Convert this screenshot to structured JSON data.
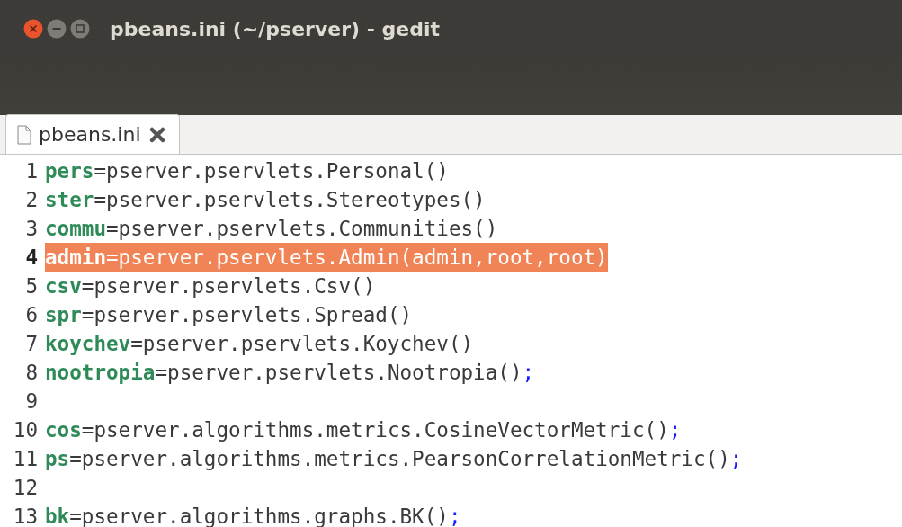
{
  "window": {
    "title": "pbeans.ini (~/pserver) - gedit"
  },
  "tabs": [
    {
      "label": "pbeans.ini",
      "selected": true
    }
  ],
  "lines": [
    {
      "number": "1",
      "selected": false,
      "tokens": [
        {
          "kind": "key",
          "text": "pers"
        },
        {
          "kind": "plain",
          "text": "=pserver.pservlets.Personal()"
        }
      ]
    },
    {
      "number": "2",
      "selected": false,
      "tokens": [
        {
          "kind": "key",
          "text": "ster"
        },
        {
          "kind": "plain",
          "text": "=pserver.pservlets.Stereotypes()"
        }
      ]
    },
    {
      "number": "3",
      "selected": false,
      "tokens": [
        {
          "kind": "key",
          "text": "commu"
        },
        {
          "kind": "plain",
          "text": "=pserver.pservlets.Communities()"
        }
      ]
    },
    {
      "number": "4",
      "selected": true,
      "tokens": [
        {
          "kind": "key",
          "text": "admin"
        },
        {
          "kind": "plain",
          "text": "=pserver.pservlets.Admin(admin,root,root)"
        }
      ]
    },
    {
      "number": "5",
      "selected": false,
      "tokens": [
        {
          "kind": "key",
          "text": "csv"
        },
        {
          "kind": "plain",
          "text": "=pserver.pservlets.Csv()"
        }
      ]
    },
    {
      "number": "6",
      "selected": false,
      "tokens": [
        {
          "kind": "key",
          "text": "spr"
        },
        {
          "kind": "plain",
          "text": "=pserver.pservlets.Spread()"
        }
      ]
    },
    {
      "number": "7",
      "selected": false,
      "tokens": [
        {
          "kind": "key",
          "text": "koychev"
        },
        {
          "kind": "plain",
          "text": "=pserver.pservlets.Koychev()"
        }
      ]
    },
    {
      "number": "8",
      "selected": false,
      "tokens": [
        {
          "kind": "key",
          "text": "nootropia"
        },
        {
          "kind": "plain",
          "text": "=pserver.pservlets.Nootropia()"
        },
        {
          "kind": "punct",
          "text": ";"
        }
      ]
    },
    {
      "number": "9",
      "selected": false
    },
    {
      "number": "10",
      "selected": false,
      "tokens": [
        {
          "kind": "key",
          "text": "cos"
        },
        {
          "kind": "plain",
          "text": "=pserver.algorithms.metrics.CosineVectorMetric()"
        },
        {
          "kind": "punct",
          "text": ";"
        }
      ]
    },
    {
      "number": "11",
      "selected": false,
      "tokens": [
        {
          "kind": "key",
          "text": "ps"
        },
        {
          "kind": "plain",
          "text": "=pserver.algorithms.metrics.PearsonCorrelationMetric()"
        },
        {
          "kind": "punct",
          "text": ";"
        }
      ]
    },
    {
      "number": "12",
      "selected": false
    },
    {
      "number": "13",
      "selected": false,
      "tokens": [
        {
          "kind": "key",
          "text": "bk"
        },
        {
          "kind": "plain",
          "text": "=pserver.algorithms.graphs.BK()"
        },
        {
          "kind": "punct",
          "text": ";"
        }
      ]
    }
  ]
}
